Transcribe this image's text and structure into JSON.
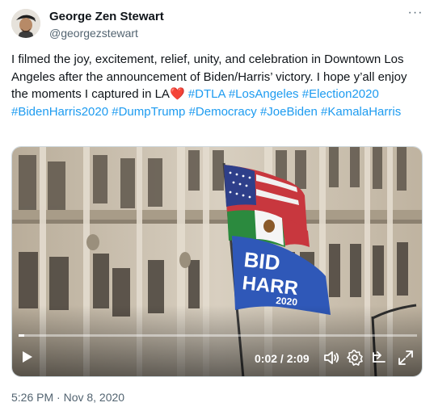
{
  "author": {
    "name": "George Zen Stewart",
    "handle": "@georgezstewart"
  },
  "tweet": {
    "text_lines": [
      "I filmed the joy, excitement, relief, unity, and celebration in Downtown",
      "Los Angeles after the announcement of Biden/Harris’ victory. I hope y’all",
      "enjoy the moments I captured in LA"
    ],
    "heart": "❤️",
    "hashtags": [
      "#DTLA",
      "#LosAngeles",
      "#Election2020",
      "#BidenHarris2020",
      "#DumpTrump",
      "#Democracy",
      "#JoeBiden",
      "#KamalaHarris"
    ],
    "timestamp": "5:26 PM · Nov 8, 2020"
  },
  "video": {
    "time_display": "0:02 / 2:09",
    "progress_fraction": 0.015,
    "flag_text_line1": "BID",
    "flag_text_line2": "HARR",
    "flag_text_line3": "2020",
    "icons": [
      "play-icon",
      "volume-icon",
      "settings-gear-icon",
      "subtitles-icon",
      "fullscreen-icon"
    ]
  },
  "header": {
    "more_label": "···"
  }
}
